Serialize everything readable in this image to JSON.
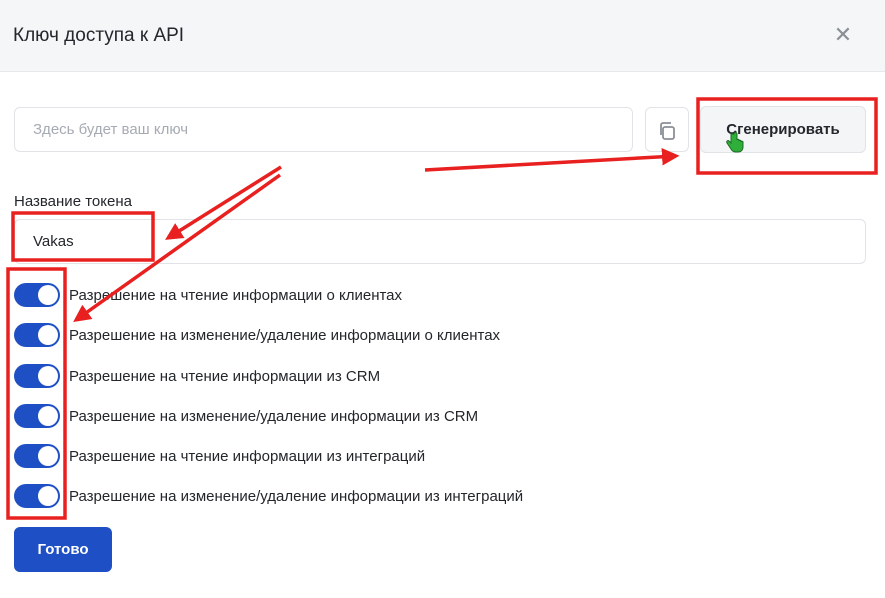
{
  "dialog": {
    "title": "Ключ доступа к API",
    "close_icon": "close-icon"
  },
  "key": {
    "placeholder": "Здесь будет ваш ключ",
    "value": "",
    "copy_icon": "copy-icon",
    "generate_label": "Сгенерировать"
  },
  "token": {
    "label": "Название токена",
    "value": "Vakas"
  },
  "permissions": [
    {
      "label": "Разрешение на чтение информации о клиентах",
      "enabled": true
    },
    {
      "label": "Разрешение на изменение/удаление информации о клиентах",
      "enabled": true
    },
    {
      "label": "Разрешение на чтение информации из CRM",
      "enabled": true
    },
    {
      "label": "Разрешение на изменение/удаление информации из CRM",
      "enabled": true
    },
    {
      "label": "Разрешение на чтение информации из интеграций",
      "enabled": true
    },
    {
      "label": "Разрешение на изменение/удаление информации из интеграций",
      "enabled": true
    }
  ],
  "actions": {
    "done_label": "Готово"
  },
  "colors": {
    "primary": "#1f4fc4",
    "annotation": "#e8201f",
    "cursor": "#2fae3a"
  }
}
